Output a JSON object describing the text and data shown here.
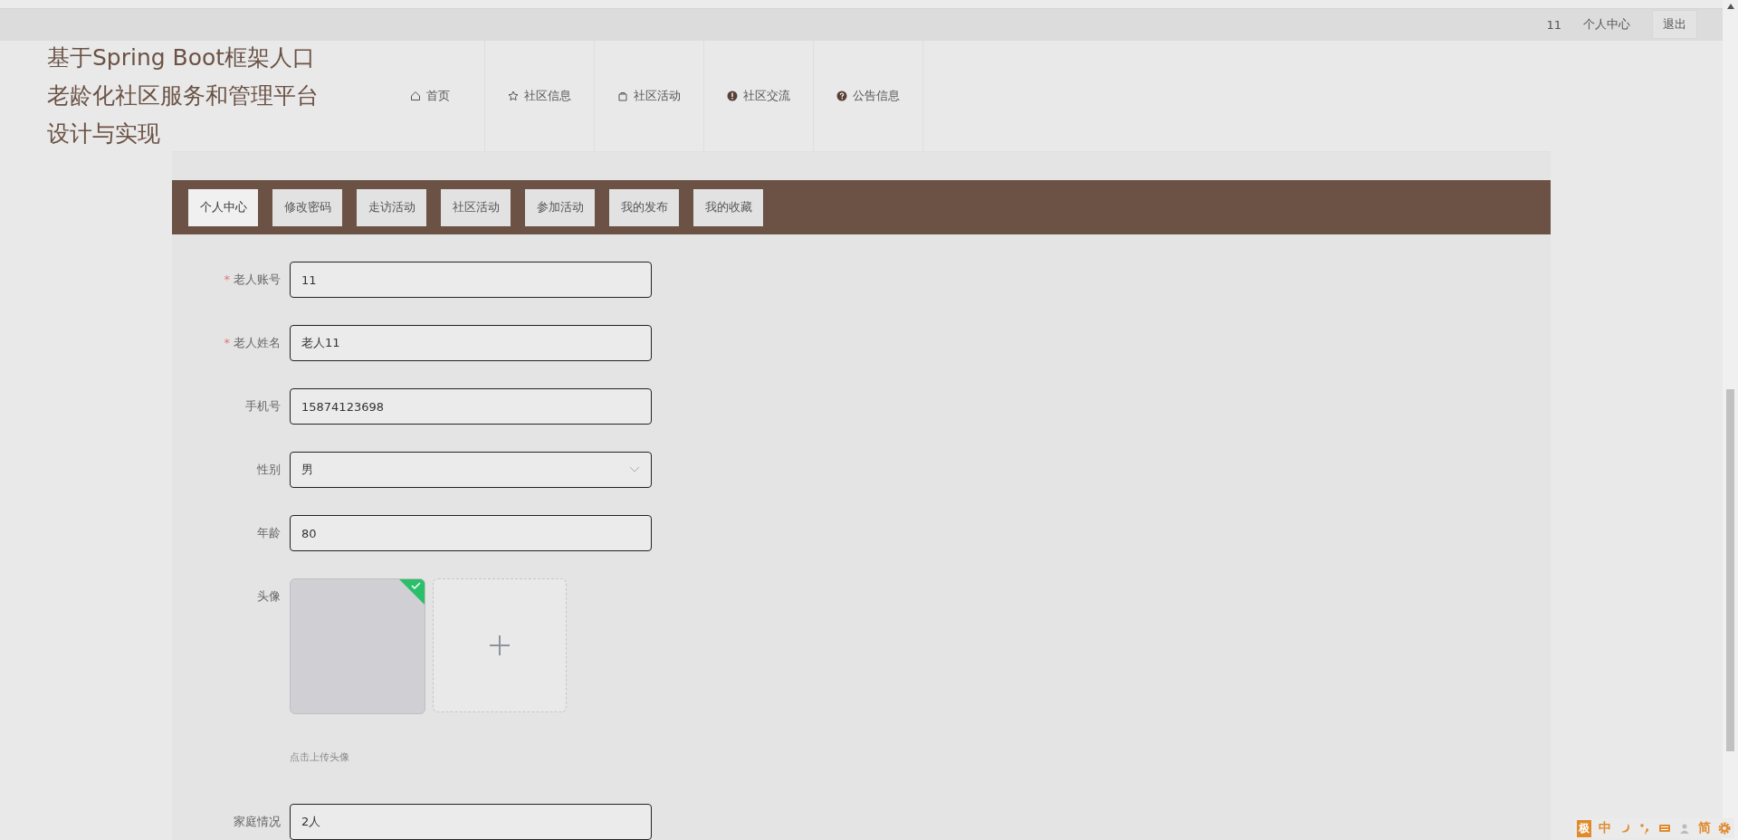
{
  "top_bar": {
    "username": "11",
    "profile_link": "个人中心",
    "logout_button": "退出"
  },
  "header": {
    "title_lines": [
      "基于Spring Boot框架人口",
      "老龄化社区服务和管理平台",
      "设计与实现"
    ],
    "nav": [
      {
        "label": "首页",
        "kind": "home"
      },
      {
        "label": "社区信息",
        "kind": "star"
      },
      {
        "label": "社区活动",
        "kind": "bag"
      },
      {
        "label": "社区交流",
        "kind": "alert"
      },
      {
        "label": "公告信息",
        "kind": "help"
      }
    ]
  },
  "tabs": [
    {
      "label": "个人中心",
      "selected": true
    },
    {
      "label": "修改密码",
      "selected": false
    },
    {
      "label": "走访活动",
      "selected": false
    },
    {
      "label": "社区活动",
      "selected": false
    },
    {
      "label": "参加活动",
      "selected": false
    },
    {
      "label": "我的发布",
      "selected": false
    },
    {
      "label": "我的收藏",
      "selected": false
    }
  ],
  "form": [
    {
      "kind": "input",
      "label": "老人账号",
      "required_mark": "*",
      "value": "11"
    },
    {
      "kind": "input",
      "label": "老人姓名",
      "required_mark": "*",
      "value": "老人11"
    },
    {
      "kind": "input",
      "label": "手机号",
      "value": "15874123698"
    },
    {
      "kind": "select",
      "label": "性别",
      "value": "男"
    },
    {
      "kind": "input",
      "label": "年龄",
      "value": "80"
    },
    {
      "kind": "upload",
      "label": "头像",
      "uploaded": true,
      "hint": "点击上传头像"
    },
    {
      "kind": "input",
      "label": "家庭情况",
      "value": "2人"
    }
  ],
  "ime_bar": [
    {
      "kind": "badge",
      "label": "极"
    },
    {
      "kind": "text",
      "label": "中"
    },
    {
      "kind": "moon"
    },
    {
      "kind": "punct"
    },
    {
      "kind": "keyboard"
    },
    {
      "kind": "user"
    },
    {
      "kind": "text",
      "label": "简"
    },
    {
      "kind": "gear"
    }
  ]
}
